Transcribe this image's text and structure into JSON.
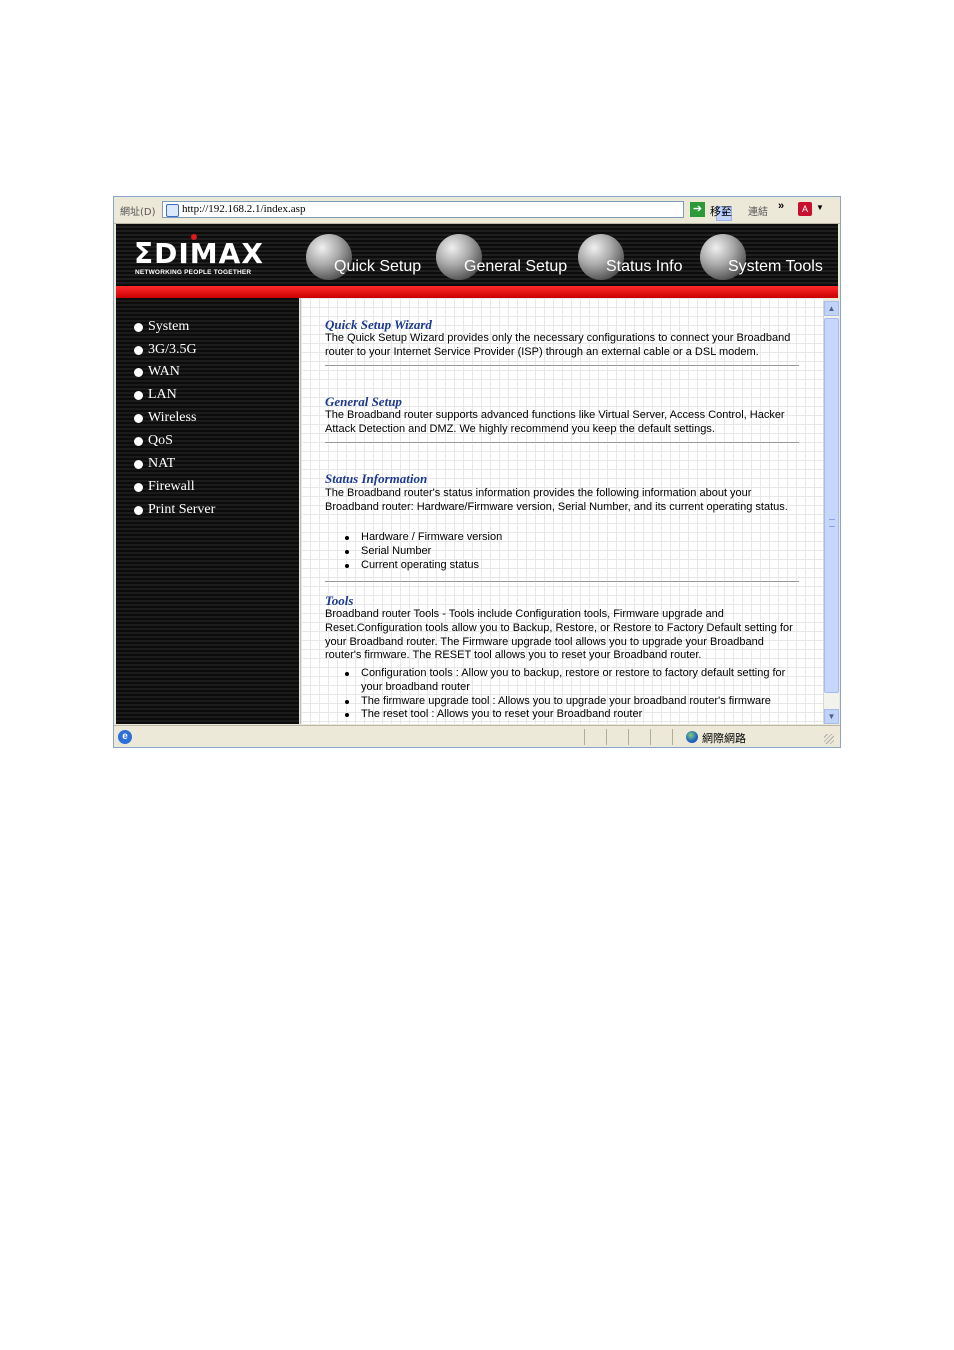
{
  "browser": {
    "address_label": "網址(D)",
    "url": "http://192.168.2.1/index.asp",
    "go_label": "移至",
    "links_label": "連結",
    "more_label": "»",
    "status_zone": "網際網路"
  },
  "brand": {
    "logo": "ΣDIMAX",
    "tagline": "NETWORKING PEOPLE TOGETHER"
  },
  "nav": [
    {
      "label": "Quick Setup"
    },
    {
      "label": "General Setup"
    },
    {
      "label": "Status Info"
    },
    {
      "label": "System Tools"
    }
  ],
  "sidebar": {
    "items": [
      {
        "label": "System"
      },
      {
        "label": "3G/3.5G"
      },
      {
        "label": "WAN"
      },
      {
        "label": "LAN"
      },
      {
        "label": "Wireless"
      },
      {
        "label": "QoS"
      },
      {
        "label": "NAT"
      },
      {
        "label": "Firewall"
      },
      {
        "label": "Print Server"
      }
    ]
  },
  "content": {
    "quick": {
      "title": "Quick Setup Wizard",
      "text": "The Quick Setup Wizard provides only the necessary configurations to connect your Broadband router to your Internet Service Provider (ISP) through an external cable or a DSL modem."
    },
    "general": {
      "title": "General Setup",
      "text": "The Broadband router supports advanced functions like Virtual Server, Access Control, Hacker Attack Detection and DMZ. We highly recommend you keep the default settings."
    },
    "status": {
      "title": "Status Information",
      "text": "The Broadband router's status information provides the following information about your Broadband router: Hardware/Firmware version, Serial Number, and its current operating status.",
      "bullets": [
        "Hardware / Firmware version",
        "Serial Number",
        "Current operating status"
      ]
    },
    "tools": {
      "title": "Tools",
      "text": "Broadband router Tools - Tools include Configuration tools, Firmware upgrade and Reset.Configuration tools allow you to Backup, Restore, or Restore to Factory Default setting for your Broadband router. The Firmware upgrade tool allows you to upgrade your Broadband router's firmware. The RESET tool allows you to reset your Broadband router.",
      "bullets": [
        "Configuration tools : Allow you to backup, restore or restore to factory default setting for your broadband router",
        "The firmware upgrade tool : Allows you to upgrade your broadband router's firmware",
        "The reset tool : Allows you to reset your Broadband router"
      ]
    }
  }
}
